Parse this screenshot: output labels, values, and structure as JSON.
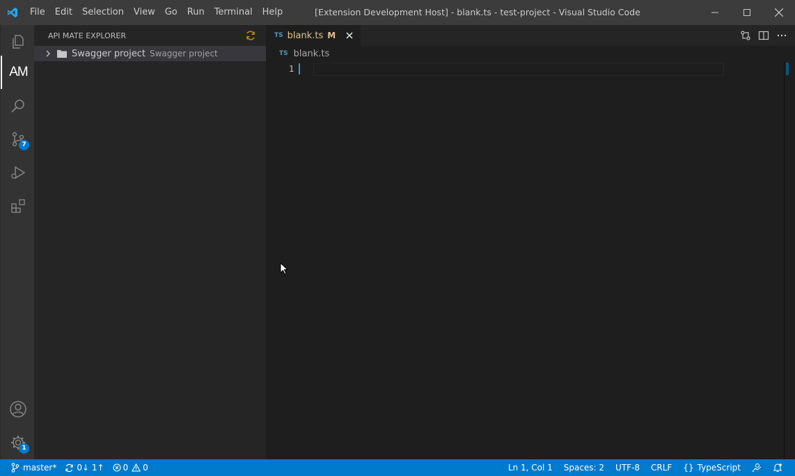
{
  "window": {
    "title": "[Extension Development Host] - blank.ts - test-project - Visual Studio Code",
    "logo": "vscode-logo"
  },
  "menu": {
    "items": [
      "File",
      "Edit",
      "Selection",
      "View",
      "Go",
      "Run",
      "Terminal",
      "Help"
    ]
  },
  "activitybar": {
    "explorer_icon": "files-icon",
    "apimate_label": "AM",
    "search_icon": "search-icon",
    "scm_icon": "source-control-icon",
    "scm_badge": "7",
    "debug_icon": "run-debug-icon",
    "extensions_icon": "extensions-icon",
    "accounts_icon": "account-icon",
    "settings_icon": "gear-icon",
    "settings_badge": "1"
  },
  "sidebar": {
    "title": "API MATE EXPLORER",
    "tree": [
      {
        "label": "Swagger project",
        "description": "Swagger project"
      }
    ]
  },
  "editor": {
    "tab": {
      "icon": "TS",
      "label": "blank.ts",
      "modified": "M"
    },
    "breadcrumb": {
      "icon": "TS",
      "label": "blank.ts"
    },
    "line_numbers": [
      "1"
    ]
  },
  "statusbar": {
    "branch": "master*",
    "sync": "0↓ 1↑",
    "errors": "0",
    "warnings": "0",
    "position": "Ln 1, Col 1",
    "spaces": "Spaces: 2",
    "encoding": "UTF-8",
    "eol": "CRLF",
    "language": "TypeScript"
  },
  "colors": {
    "titlebar": "#3c3c3c",
    "activitybar": "#333333",
    "sidebar": "#252526",
    "editor": "#1e1e1e",
    "statusbar": "#007acc",
    "modified": "#e2c08d",
    "ts": "#519aba"
  }
}
